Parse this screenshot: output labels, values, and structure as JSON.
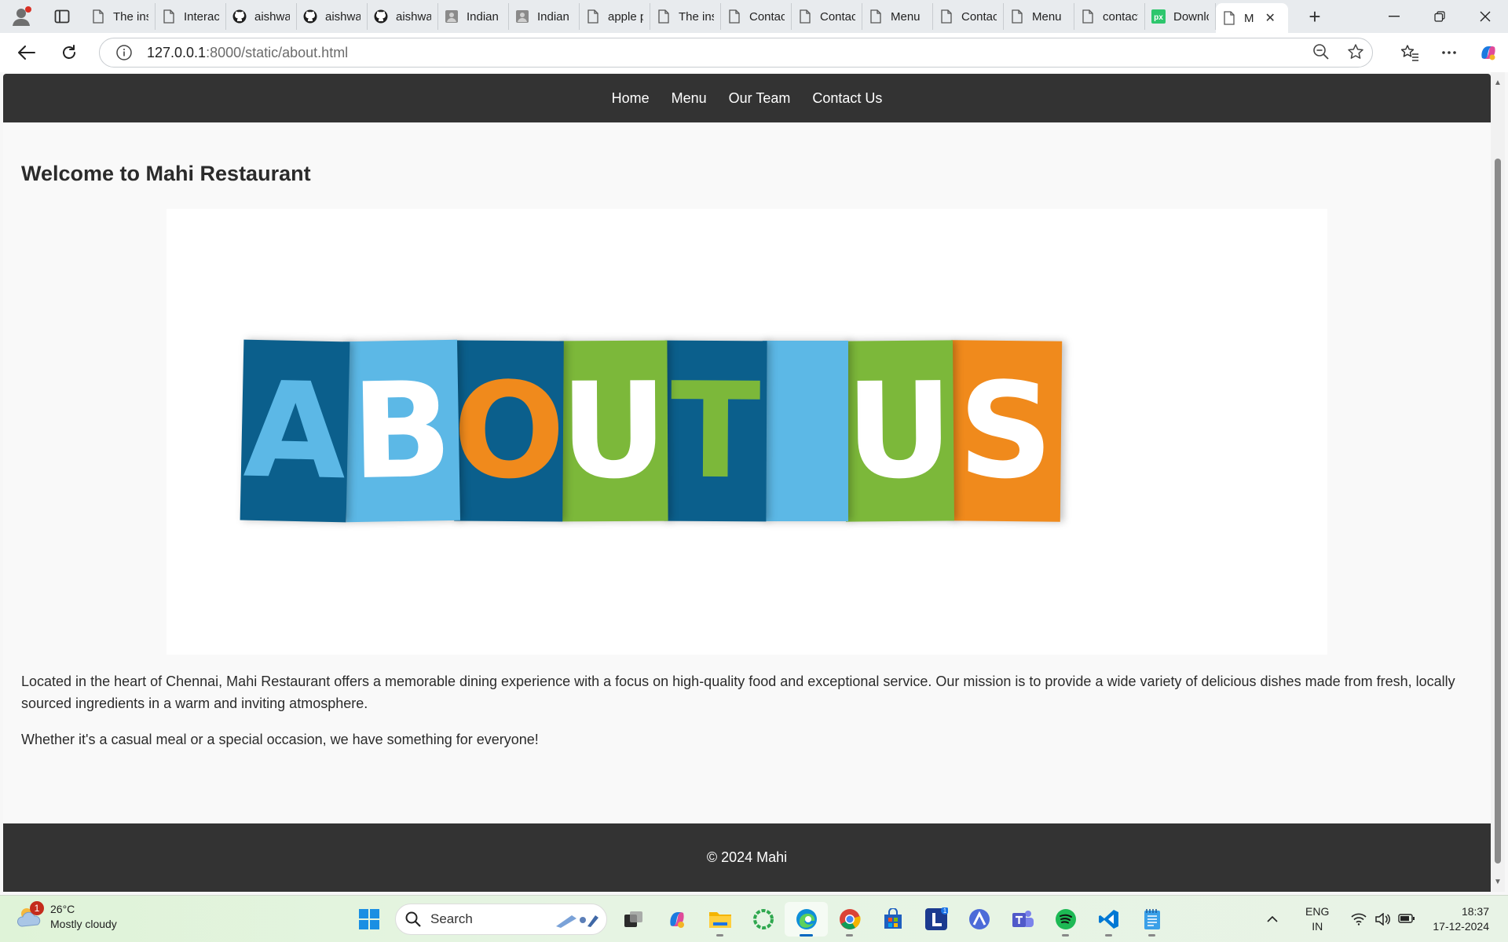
{
  "browser": {
    "tabs": [
      {
        "label": "The ins",
        "icon": "page-icon"
      },
      {
        "label": "Interact",
        "icon": "page-icon"
      },
      {
        "label": "aishwa",
        "icon": "github-icon"
      },
      {
        "label": "aishwa",
        "icon": "github-icon"
      },
      {
        "label": "aishwa",
        "icon": "github-icon"
      },
      {
        "label": "Indian",
        "icon": "image-icon"
      },
      {
        "label": "Indian",
        "icon": "image-icon"
      },
      {
        "label": "apple p",
        "icon": "page-icon"
      },
      {
        "label": "The ins",
        "icon": "page-icon"
      },
      {
        "label": "Contac",
        "icon": "page-icon"
      },
      {
        "label": "Contac",
        "icon": "page-icon"
      },
      {
        "label": "Menu",
        "icon": "page-icon"
      },
      {
        "label": "Contac",
        "icon": "page-icon"
      },
      {
        "label": "Menu",
        "icon": "page-icon"
      },
      {
        "label": "contact",
        "icon": "page-icon"
      },
      {
        "label": "Downlo",
        "icon": "pixabay-icon"
      }
    ],
    "active_tab": {
      "label": "M",
      "icon": "page-icon"
    },
    "url_host": "127.0.0.1",
    "url_path": ":8000/static/about.html"
  },
  "site": {
    "nav": [
      "Home",
      "Menu",
      "Our Team",
      "Contact Us"
    ],
    "title": "Welcome to Mahi Restaurant",
    "hero_letters": [
      {
        "char": "A",
        "bg": "#0b5f8c",
        "fg": "#5cb8e6"
      },
      {
        "char": "B",
        "bg": "#5cb8e6",
        "fg": "#ffffff"
      },
      {
        "char": "O",
        "bg": "#0b5f8c",
        "fg": "#f08a1c"
      },
      {
        "char": "U",
        "bg": "#7cb83a",
        "fg": "#ffffff"
      },
      {
        "char": "T",
        "bg": "#0b5f8c",
        "fg": "#7cb83a"
      },
      {
        "char": "",
        "bg": "#5cb8e6",
        "fg": "#ffffff"
      },
      {
        "char": "U",
        "bg": "#7cb83a",
        "fg": "#ffffff"
      },
      {
        "char": "S",
        "bg": "#f08a1c",
        "fg": "#ffffff"
      }
    ],
    "paragraph1": "Located in the heart of Chennai, Mahi Restaurant offers a memorable dining experience with a focus on high-quality food and exceptional service. Our mission is to provide a wide variety of delicious dishes made from fresh, locally sourced ingredients in a warm and inviting atmosphere.",
    "paragraph2": "Whether it's a casual meal or a special occasion, we have something for everyone!",
    "footer": "© 2024 Mahi"
  },
  "taskbar": {
    "weather_temp": "26°C",
    "weather_desc": "Mostly cloudy",
    "weather_badge": "1",
    "search_placeholder": "Search",
    "lang_line1": "ENG",
    "lang_line2": "IN",
    "time": "18:37",
    "date": "17-12-2024",
    "apps": [
      "windows-start-icon",
      "task-view-icon",
      "copilot-icon",
      "file-explorer-icon",
      "circle-app-icon",
      "edge-icon",
      "chrome-icon",
      "store-icon",
      "l-app-icon",
      "arc-app-icon",
      "teams-icon",
      "spotify-icon",
      "vscode-icon",
      "notepad-icon"
    ],
    "l_app_badge": "1"
  }
}
